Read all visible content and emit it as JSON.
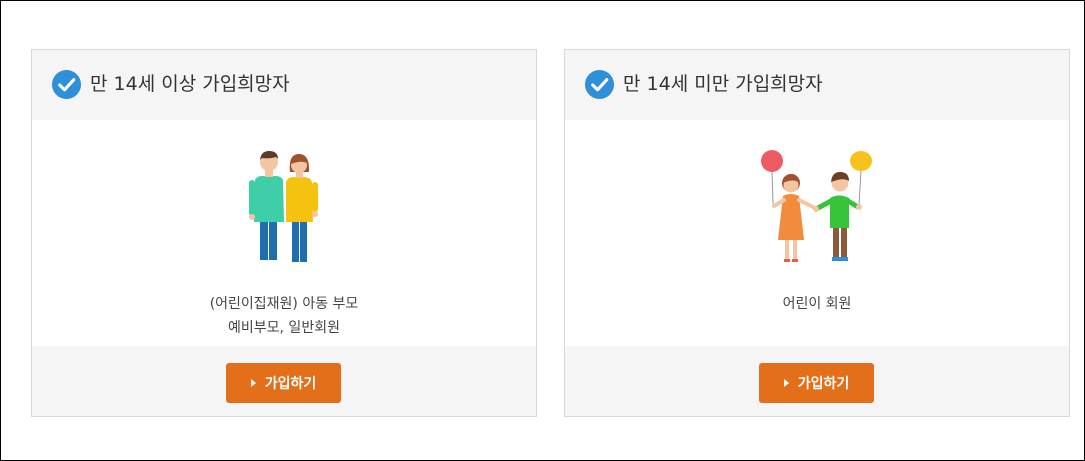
{
  "cards": [
    {
      "title": "만 14세 이상 가입희망자",
      "description": [
        "(어린이집재원) 아동 부모",
        "예비부모, 일반회원"
      ],
      "illustration": "adult-couple-illustration",
      "button_label": "가입하기"
    },
    {
      "title": "만 14세 미만 가입희망자",
      "description": [
        "어린이 회원"
      ],
      "illustration": "children-with-balloons-illustration",
      "button_label": "가입하기"
    }
  ],
  "colors": {
    "accent": "#e46f1a",
    "check": "#2f8fd8",
    "header_bg": "#f5f5f5",
    "border": "#d8d8d8"
  },
  "icons": {
    "check": "check-circle-icon",
    "button_arrow": "triangle-right-icon"
  }
}
